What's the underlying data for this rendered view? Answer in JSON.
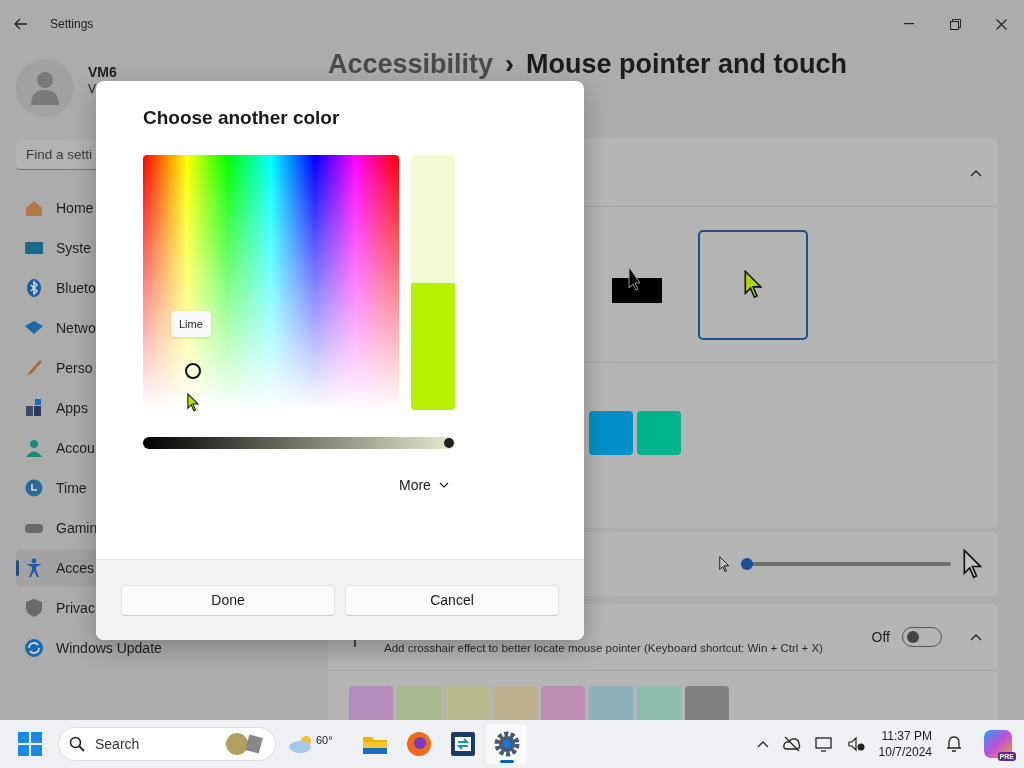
{
  "window": {
    "title": "Settings"
  },
  "account": {
    "name": "VM6",
    "subtitle": "V"
  },
  "search": {
    "placeholder": "Find a setti"
  },
  "sidebar": {
    "items": [
      {
        "label": "Home",
        "kind": "home",
        "selected": false
      },
      {
        "label": "Syste",
        "kind": "system",
        "selected": false
      },
      {
        "label": "Blueto",
        "kind": "bluetooth",
        "selected": false
      },
      {
        "label": "Netwo",
        "kind": "network",
        "selected": false
      },
      {
        "label": "Perso",
        "kind": "brush",
        "selected": false
      },
      {
        "label": "Apps",
        "kind": "apps",
        "selected": false
      },
      {
        "label": "Accou",
        "kind": "account",
        "selected": false
      },
      {
        "label": "Time",
        "kind": "time",
        "selected": false
      },
      {
        "label": "Gamin",
        "kind": "gaming",
        "selected": false
      },
      {
        "label": "Acces",
        "kind": "accessibility",
        "selected": true
      },
      {
        "label": "Privac",
        "kind": "privacy",
        "selected": false
      },
      {
        "label": "Windows Update",
        "kind": "update",
        "selected": false
      }
    ]
  },
  "breadcrumb": {
    "parent": "Accessibility",
    "separator": "›",
    "current": "Mouse pointer and touch"
  },
  "pointer_styles": {
    "expanded": true,
    "tiles": [
      {
        "kind": "inverted",
        "selected": false
      },
      {
        "kind": "custom",
        "selected": true
      }
    ],
    "swatches": [
      {
        "color": "#0090c8"
      },
      {
        "color": "#00b48c"
      }
    ]
  },
  "pointer_size": {
    "level": 0
  },
  "crosshair": {
    "description": "Add crosshair effect to better locate mouse pointer (Keyboard shortcut: Win + Ctrl + X)",
    "state_label": "Off",
    "on": false,
    "expanded": true,
    "swatches": [
      {
        "color": "#b48cbc"
      },
      {
        "color": "#a8b88c"
      },
      {
        "color": "#b8bc8c"
      },
      {
        "color": "#bcb08c"
      },
      {
        "color": "#bc8cb4"
      },
      {
        "color": "#8cb0bc"
      },
      {
        "color": "#8cbcac"
      },
      {
        "color": "#808080"
      }
    ]
  },
  "dialog": {
    "title": "Choose another color",
    "tooltip": "Lime",
    "value_bar": {
      "level": 0.5
    },
    "brightness": {
      "level": 1
    },
    "more": "More",
    "buttons": [
      "Done",
      "Cancel"
    ]
  },
  "taskbar": {
    "search_placeholder": "Search",
    "weather": "60°",
    "apps": [
      {
        "kind": "folder",
        "active": false
      },
      {
        "kind": "firefox",
        "active": false
      },
      {
        "kind": "remote",
        "active": false
      },
      {
        "kind": "settings",
        "active": true
      }
    ],
    "time": "11:37 PM",
    "date": "10/7/2024",
    "badge": "PRE"
  }
}
